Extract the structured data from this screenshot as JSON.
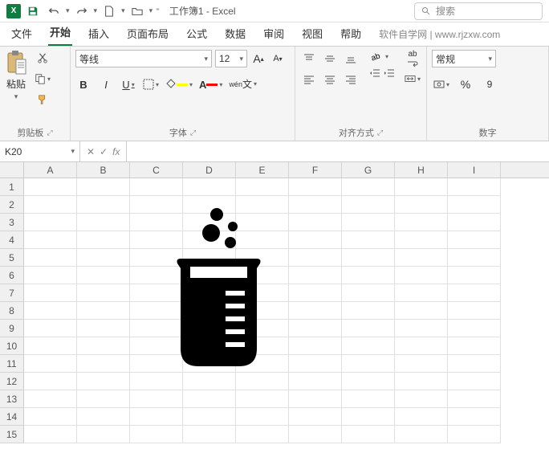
{
  "titlebar": {
    "app_abbrev": "X",
    "title": "工作簿1 - Excel",
    "search_placeholder": "搜索"
  },
  "tabs": {
    "items": [
      {
        "label": "文件"
      },
      {
        "label": "开始",
        "active": true
      },
      {
        "label": "插入"
      },
      {
        "label": "页面布局"
      },
      {
        "label": "公式"
      },
      {
        "label": "数据"
      },
      {
        "label": "审阅"
      },
      {
        "label": "视图"
      },
      {
        "label": "帮助"
      }
    ],
    "help_link": "软件自学网 | www.rjzxw.com"
  },
  "ribbon": {
    "clipboard": {
      "paste_label": "粘贴",
      "group_label": "剪贴板"
    },
    "font": {
      "name": "等线",
      "size": "12",
      "bold": "B",
      "italic": "I",
      "underline": "U",
      "wen": "wén",
      "group_label": "字体",
      "grow_label": "A",
      "shrink_label": "A"
    },
    "alignment": {
      "group_label": "对齐方式",
      "wrap_label": "ab"
    },
    "number": {
      "format": "常规",
      "percent": "%",
      "comma": "9",
      "group_label": "数字"
    }
  },
  "formula_bar": {
    "name_box": "K20",
    "fx": "fx",
    "cancel": "✕",
    "confirm": "✓",
    "formula": ""
  },
  "grid": {
    "columns": [
      "A",
      "B",
      "C",
      "D",
      "E",
      "F",
      "G",
      "H",
      "I"
    ],
    "rows": [
      "1",
      "2",
      "3",
      "4",
      "5",
      "6",
      "7",
      "8",
      "9",
      "10",
      "11",
      "12",
      "13",
      "14",
      "15"
    ]
  },
  "icons": {
    "save": "save-icon",
    "undo": "undo-icon",
    "redo": "redo-icon",
    "new": "new-file-icon",
    "open": "open-folder-icon"
  },
  "inserted_shape": {
    "name": "beaker-icon",
    "description": "化学烧杯图标，有液体与气泡"
  }
}
